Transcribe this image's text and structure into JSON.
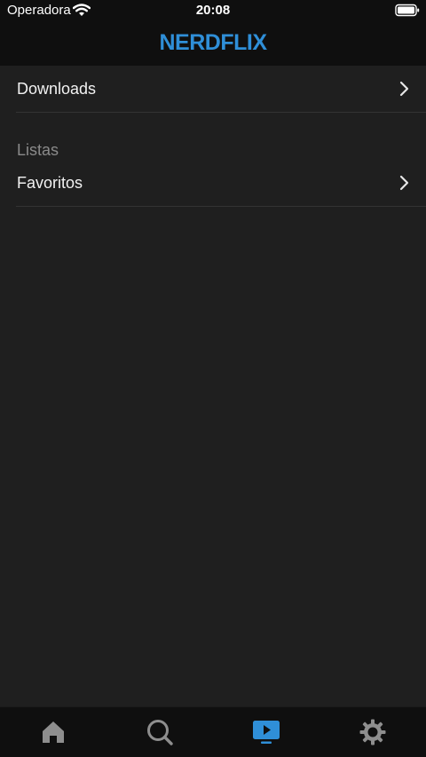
{
  "status_bar": {
    "carrier": "Operadora",
    "time": "20:08",
    "wifi_icon": "wifi-icon",
    "battery_icon": "battery-icon"
  },
  "header": {
    "logo_text": "NERDFLIX",
    "logo_color": "#2f8fd8"
  },
  "menu": {
    "downloads_label": "Downloads",
    "section_title": "Listas",
    "favoritos_label": "Favoritos",
    "chevron_icon": "chevron-right-icon"
  },
  "tabbar": {
    "tabs": [
      {
        "icon": "home-icon",
        "active": false
      },
      {
        "icon": "search-icon",
        "active": false
      },
      {
        "icon": "play-tv-icon",
        "active": true
      },
      {
        "icon": "gear-icon",
        "active": false
      }
    ],
    "active_color": "#2f8fd8",
    "inactive_color": "#8e8e8e"
  },
  "colors": {
    "background": "#1f1f1f",
    "header_background": "#0f0f0f",
    "separator": "#343434",
    "section_text": "#8a8a8a"
  }
}
